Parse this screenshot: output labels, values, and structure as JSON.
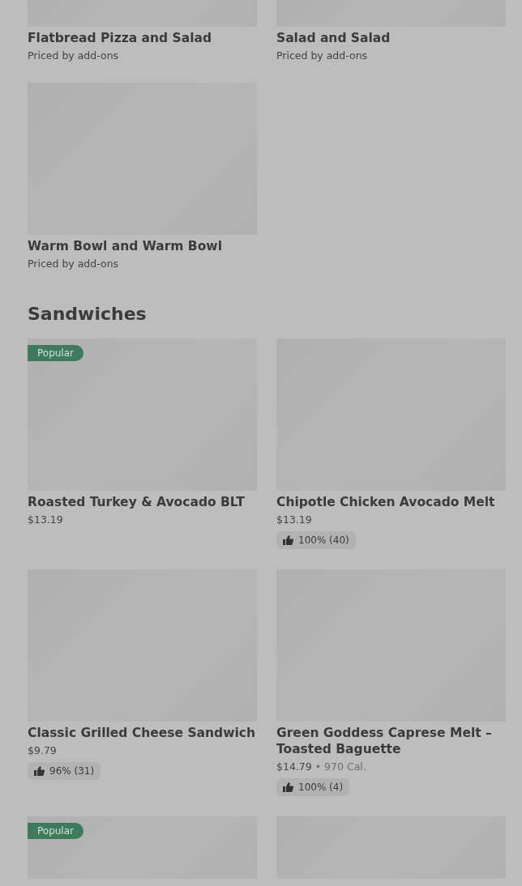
{
  "sections": [
    {
      "items": [
        {
          "name": "Flatbread Pizza and Salad",
          "price": "Priced by add-ons"
        },
        {
          "name": "Salad and Salad",
          "price": "Priced by add-ons"
        },
        {
          "name": "Warm Bowl and Warm Bowl",
          "price": "Priced by add-ons"
        }
      ]
    },
    {
      "heading": "Sandwiches",
      "items": [
        {
          "badge": "Popular",
          "name": "Roasted Turkey & Avocado BLT",
          "price": "$13.19"
        },
        {
          "name": "Chipotle Chicken Avocado Melt",
          "price": "$13.19",
          "rating": "100% (40)"
        },
        {
          "name": "Classic Grilled Cheese Sandwich",
          "price": "$9.79",
          "rating": "96% (31)"
        },
        {
          "name": "Green Goddess Caprese Melt – Toasted Baguette",
          "price": "$14.79",
          "separator": "•",
          "calories": "970 Cal.",
          "rating": "100% (4)"
        },
        {
          "kind": "image_only",
          "badge": "Popular"
        },
        {
          "kind": "image_only"
        }
      ]
    }
  ]
}
